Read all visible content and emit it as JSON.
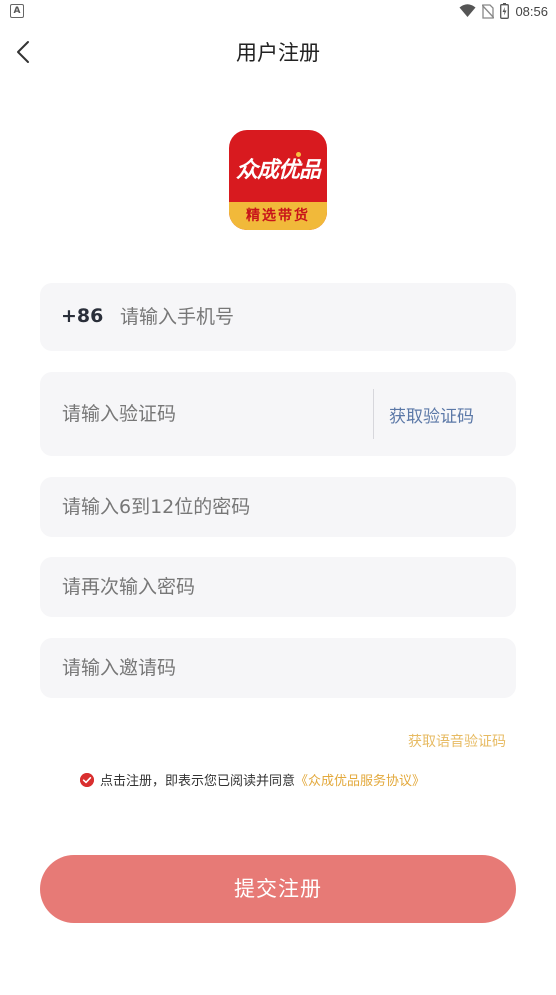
{
  "status_bar": {
    "app_indicator": "A",
    "time": "08:56"
  },
  "nav": {
    "title": "用户注册"
  },
  "logo": {
    "main_text": "众成优品",
    "band_text": "精选带货"
  },
  "form": {
    "country_code": "+86",
    "phone_placeholder": "请输入手机号",
    "code_placeholder": "请输入验证码",
    "get_code_label": "获取验证码",
    "password_placeholder": "请输入6到12位的密码",
    "confirm_password_placeholder": "请再次输入密码",
    "invite_placeholder": "请输入邀请码",
    "voice_code_label": "获取语音验证码"
  },
  "agreement": {
    "prefix": "点击注册，即表示您已阅读并同意",
    "link": "《众成优品服务协议》",
    "checked": true
  },
  "submit": {
    "label": "提交注册"
  },
  "colors": {
    "brand_red": "#d81a1f",
    "gold": "#f1b93a",
    "button": "#e77a76",
    "link_blue": "#5b78a7",
    "link_gold": "#e3a93c"
  },
  "icons": {
    "back": "chevron-left-icon",
    "wifi": "wifi-icon",
    "no_sim": "no-sim-icon",
    "battery": "battery-icon",
    "check": "check-circle-icon"
  }
}
